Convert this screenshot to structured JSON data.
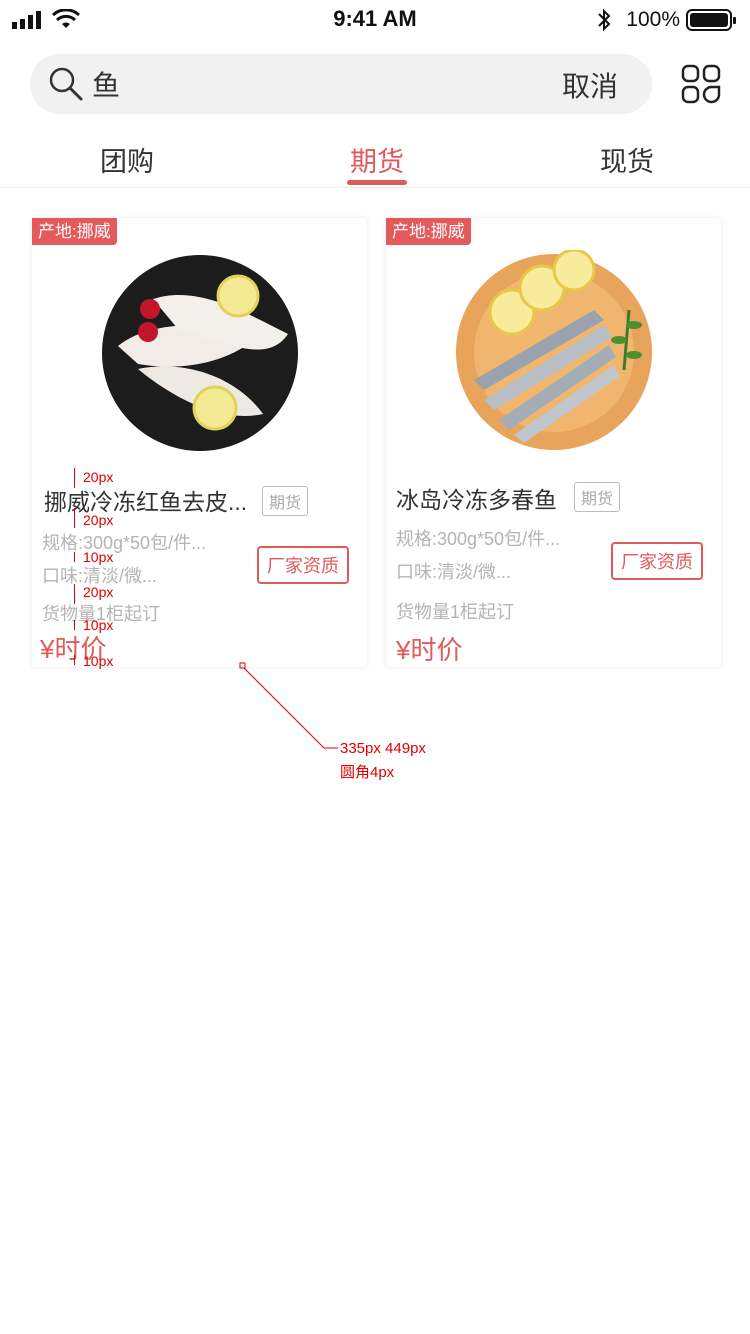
{
  "status_bar": {
    "time": "9:41 AM",
    "battery": "100%"
  },
  "search": {
    "query": "鱼",
    "cancel_label": "取消"
  },
  "tabs": [
    {
      "label": "团购",
      "active": false
    },
    {
      "label": "期货",
      "active": true
    },
    {
      "label": "现货",
      "active": false
    }
  ],
  "products": [
    {
      "origin_badge": "产地:挪威",
      "title": "挪威冷冻红鱼去皮...",
      "type_tag": "期货",
      "spec": "规格:300g*50包/件...",
      "flavor": "口味:清淡/微...",
      "quantity": "货物量1柜起订",
      "price": "¥时价",
      "factory_button": "厂家资质"
    },
    {
      "origin_badge": "产地:挪威",
      "title": "冰岛冷冻多春鱼",
      "type_tag": "期货",
      "spec": "规格:300g*50包/件...",
      "flavor": "口味:清淡/微...",
      "quantity": "货物量1柜起订",
      "price": "¥时价",
      "factory_button": "厂家资质"
    }
  ],
  "annotations": {
    "gap_20_a": "20px",
    "gap_20_b": "20px",
    "gap_10_a": "10px",
    "gap_20_c": "20px",
    "gap_10_b": "10px",
    "gap_10_c": "10px",
    "card_size": "335px 449px",
    "card_radius": "圆角4px"
  },
  "colors": {
    "accent": "#e05a5a",
    "annotation": "#e00000"
  }
}
